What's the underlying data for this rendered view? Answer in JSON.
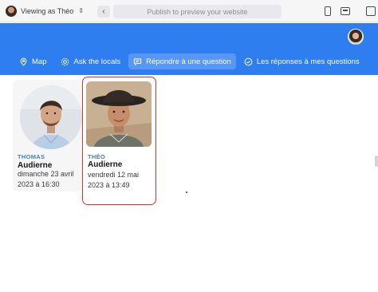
{
  "toolbar": {
    "viewing_as": "Viewing as Théo",
    "url_placeholder": "Publish to preview your website",
    "back_symbol": "‹"
  },
  "nav": {
    "items": [
      {
        "label": "Map",
        "icon": "map-pin-icon",
        "active": false
      },
      {
        "label": "Ask the locals",
        "icon": "settings-icon",
        "active": false
      },
      {
        "label": "Répondre à une question",
        "icon": "chat-bubble-icon",
        "active": true
      },
      {
        "label": "Les réponses à mes questions",
        "icon": "check-circle-icon",
        "active": false
      }
    ]
  },
  "cards": [
    {
      "role": "THOMAS",
      "name": "Audierne",
      "date_line1": "dimanche 23 avril",
      "date_line2": "2023 à 16:30",
      "selected": false
    },
    {
      "role": "THÉO",
      "name": "Audierne",
      "date_line1": "vendredi 12 mai",
      "date_line2": "2023 à 13:49",
      "selected": true
    }
  ],
  "colors": {
    "header_bg": "#2f7ef0",
    "selected_border": "#d9312b",
    "role_text": "#4a7fb8"
  }
}
